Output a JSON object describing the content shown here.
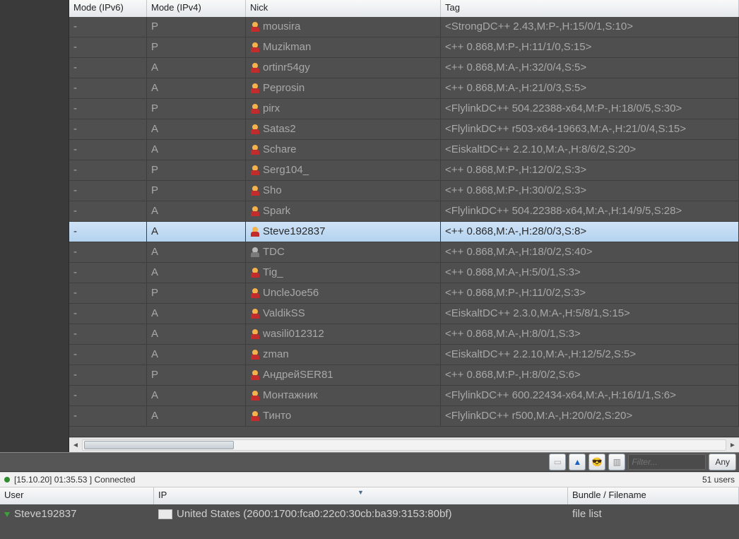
{
  "columns": {
    "mode_v6": "Mode (IPv6)",
    "mode_v4": "Mode (IPv4)",
    "nick": "Nick",
    "tag": "Tag"
  },
  "selected_index": 10,
  "rows": [
    {
      "mode6": "-",
      "mode4": "P",
      "away": false,
      "nick": "mousira",
      "tag": "<StrongDC++ 2.43,M:P-,H:15/0/1,S:10>"
    },
    {
      "mode6": "-",
      "mode4": "P",
      "away": false,
      "nick": "Muzikman",
      "tag": "<++ 0.868,M:P-,H:11/1/0,S:15>"
    },
    {
      "mode6": "-",
      "mode4": "A",
      "away": false,
      "nick": "ortinr54gy",
      "tag": "<++ 0.868,M:A-,H:32/0/4,S:5>"
    },
    {
      "mode6": "-",
      "mode4": "A",
      "away": false,
      "nick": "Peprosin",
      "tag": "<++ 0.868,M:A-,H:21/0/3,S:5>"
    },
    {
      "mode6": "-",
      "mode4": "P",
      "away": false,
      "nick": "pirx",
      "tag": "<FlylinkDC++ 504.22388-x64,M:P-,H:18/0/5,S:30>"
    },
    {
      "mode6": "-",
      "mode4": "A",
      "away": false,
      "nick": "Satas2",
      "tag": "<FlylinkDC++ r503-x64-19663,M:A-,H:21/0/4,S:15>"
    },
    {
      "mode6": "-",
      "mode4": "A",
      "away": false,
      "nick": "Schare",
      "tag": "<EiskaltDC++ 2.2.10,M:A-,H:8/6/2,S:20>"
    },
    {
      "mode6": "-",
      "mode4": "P",
      "away": false,
      "nick": "Serg104_",
      "tag": "<++ 0.868,M:P-,H:12/0/2,S:3>"
    },
    {
      "mode6": "-",
      "mode4": "P",
      "away": false,
      "nick": "Sho",
      "tag": "<++ 0.868,M:P-,H:30/0/2,S:3>"
    },
    {
      "mode6": "-",
      "mode4": "A",
      "away": false,
      "nick": "Spark",
      "tag": "<FlylinkDC++ 504.22388-x64,M:A-,H:14/9/5,S:28>"
    },
    {
      "mode6": "-",
      "mode4": "A",
      "away": false,
      "nick": "Steve192837",
      "tag": "<++ 0.868,M:A-,H:28/0/3,S:8>"
    },
    {
      "mode6": "-",
      "mode4": "A",
      "away": true,
      "nick": "TDC",
      "tag": "<++ 0.868,M:A-,H:18/0/2,S:40>"
    },
    {
      "mode6": "-",
      "mode4": "A",
      "away": false,
      "nick": "Tig_",
      "tag": "<++ 0.868,M:A-,H:5/0/1,S:3>"
    },
    {
      "mode6": "-",
      "mode4": "P",
      "away": false,
      "nick": "UncleJoe56",
      "tag": "<++ 0.868,M:P-,H:11/0/2,S:3>"
    },
    {
      "mode6": "-",
      "mode4": "A",
      "away": false,
      "nick": "ValdikSS",
      "tag": "<EiskaltDC++ 2.3.0,M:A-,H:5/8/1,S:15>"
    },
    {
      "mode6": "-",
      "mode4": "A",
      "away": false,
      "nick": "wasili012312",
      "tag": "<++ 0.868,M:A-,H:8/0/1,S:3>"
    },
    {
      "mode6": "-",
      "mode4": "A",
      "away": false,
      "nick": "zman",
      "tag": "<EiskaltDC++ 2.2.10,M:A-,H:12/5/2,S:5>"
    },
    {
      "mode6": "-",
      "mode4": "P",
      "away": false,
      "nick": "АндрейSER81",
      "tag": "<++ 0.868,M:P-,H:8/0/2,S:6>"
    },
    {
      "mode6": "-",
      "mode4": "A",
      "away": false,
      "nick": "Монтажник",
      "tag": "<FlylinkDC++ 600.22434-x64,M:A-,H:16/1/1,S:6>"
    },
    {
      "mode6": "-",
      "mode4": "A",
      "away": false,
      "nick": "Тинто",
      "tag": "<FlylinkDC++ r500,M:A-,H:20/0/2,S:20>"
    }
  ],
  "toolbar": {
    "filter_placeholder": "Filter...",
    "any_label": "Any"
  },
  "status": {
    "timestamp": "[15.10.20] 01:35.53 ]",
    "message": "Connected",
    "users": "51 users"
  },
  "bottom_columns": {
    "user": "User",
    "ip": "IP",
    "bundle": "Bundle / Filename"
  },
  "transfers": [
    {
      "user": "Steve192837",
      "ip": "United States (2600:1700:fca0:22c0:30cb:ba39:3153:80bf)",
      "file": "file list"
    }
  ]
}
